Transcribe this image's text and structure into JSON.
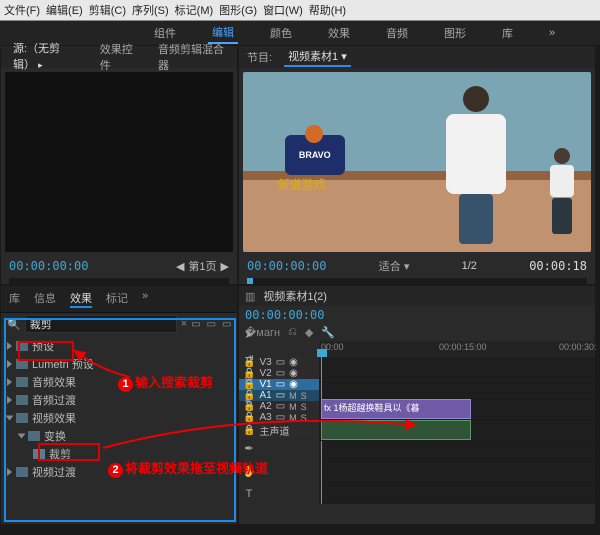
{
  "menu": {
    "file": "文件(F)",
    "edit": "编辑(E)",
    "clip": "剪辑(C)",
    "seq": "序列(S)",
    "mark": "标记(M)",
    "graphics": "图形(G)",
    "window": "窗口(W)",
    "help": "帮助(H)"
  },
  "workspace_tabs": {
    "assembly": "组件",
    "editing": "编辑",
    "color": "颜色",
    "effects": "效果",
    "audio": "音频",
    "graphics": "图形",
    "library": "库"
  },
  "source": {
    "tabs": {
      "none": "源:（无剪辑）",
      "fx": "效果控件",
      "audiomix": "音频剪辑混合器"
    },
    "tc": "00:00:00:00",
    "page_label": "第1页"
  },
  "program": {
    "title_prefix": "节目:",
    "title": "视频素材1",
    "logo1": "BRAVO",
    "logo2": "新道游戏",
    "tc_left": "00:00:00:00",
    "fit": "适合",
    "ratio": "1/2",
    "tc_right": "00:00:18"
  },
  "effects": {
    "tabs": {
      "lib": "库",
      "info": "信息",
      "fx": "效果",
      "mark": "标记"
    },
    "search_value": "裁剪",
    "folders": {
      "presets": "预设",
      "lumetri": "Lumetri 预设",
      "audioFx": "音频效果",
      "audioTrans": "音频过渡",
      "videoFx": "视频效果",
      "transform": "变换",
      "crop": "裁剪",
      "videoTrans": "视频过渡"
    }
  },
  "timeline": {
    "title": "视频素材1(2)",
    "tc": "00:00:00:00",
    "ruler": {
      "t0": "00:00",
      "t1": "00:00:15:00",
      "t2": "00:00:30:"
    },
    "tracks": {
      "v3": "V3",
      "v2": "V2",
      "v1": "V1",
      "a1": "A1",
      "a2": "A2",
      "a3": "A3",
      "master": "主声道"
    },
    "clip_name": "1杨超越换鞋具以《暮",
    "eye": "◉",
    "m": "M",
    "s": "S",
    "lock": "🔒",
    "fx": "fx",
    "mute": "◯"
  },
  "annot": {
    "a1": "输入搜索裁剪",
    "a2": "将裁剪效果拖至视频轨道"
  }
}
